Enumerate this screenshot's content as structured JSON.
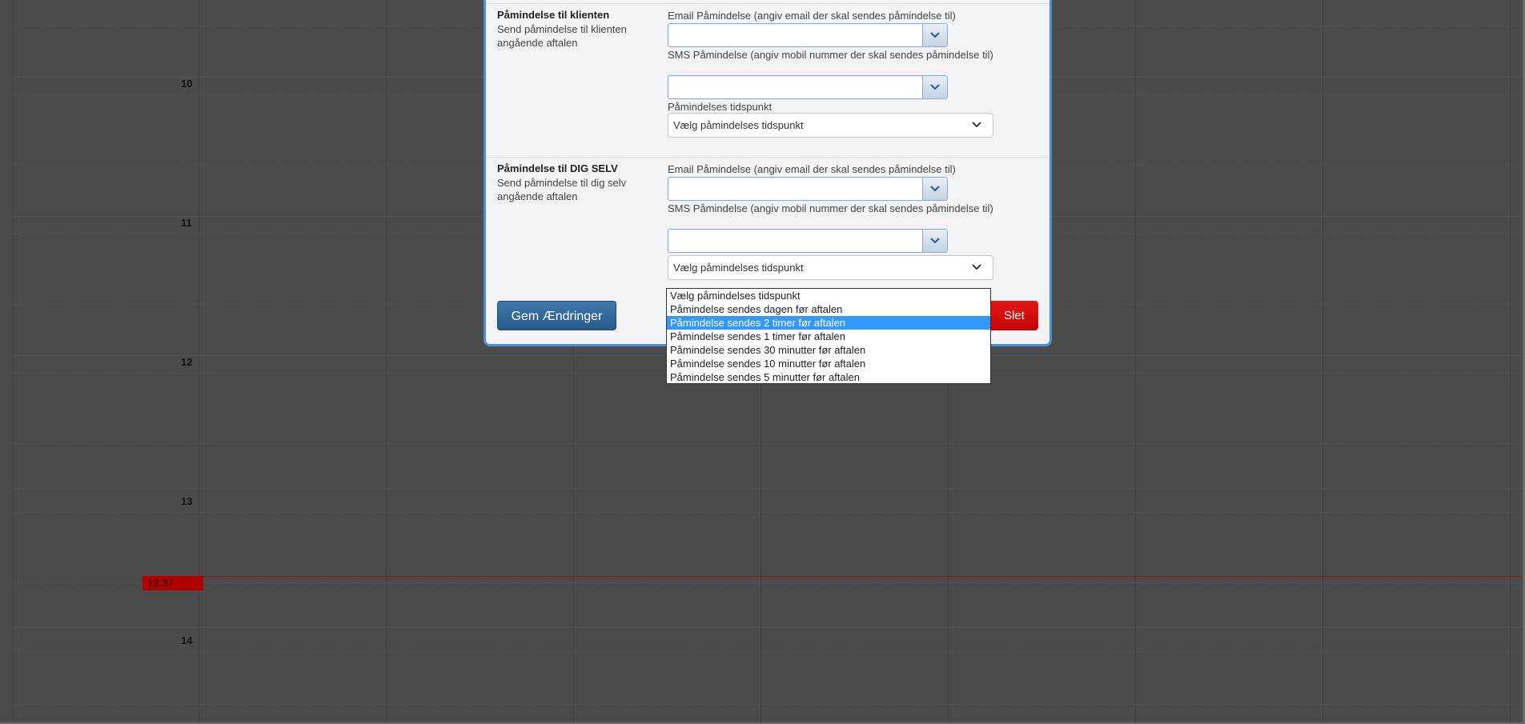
{
  "calendar": {
    "hours": [
      "10",
      "11",
      "12",
      "13",
      "14"
    ],
    "now_label": "13:37"
  },
  "dialog": {
    "section_client": {
      "title": "Påmindelse til klienten",
      "description": "Send påmindelse til klienten angående aftalen",
      "email_label": "Email Påmindelse (angiv email der skal sendes påmindelse til)",
      "email_value": "",
      "sms_label": "SMS Påmindelse (angiv mobil nummer der skal sendes påmindelse til)",
      "sms_value": "",
      "time_label": "Påmindelses tidspunkt",
      "time_value": "Vælg påmindelses tidspunkt"
    },
    "section_self": {
      "title": "Påmindelse til DIG SELV",
      "description": "Send påmindelse til dig selv angående aftalen",
      "email_label": "Email Påmindelse (angiv email der skal sendes påmindelse til)",
      "email_value": "",
      "sms_label": "SMS Påmindelse (angiv mobil nummer der skal sendes påmindelse til)",
      "sms_value": "",
      "time_value": "Vælg påmindelses tidspunkt"
    },
    "save_label": "Gem Ændringer",
    "delete_label": "Slet"
  },
  "dropdown": {
    "options": [
      "Vælg påmindelses tidspunkt",
      "Påmindelse sendes dagen før aftalen",
      "Påmindelse sendes 2 timer før aftalen",
      "Påmindelse sendes 1 timer før aftalen",
      "Påmindelse sendes 30 minutter før aftalen",
      "Påmindelse sendes 10 minutter før aftalen",
      "Påmindelse sendes 5 minutter før aftalen"
    ],
    "highlighted_index": 2
  },
  "colors": {
    "dialog_border": "#4a90d9",
    "save_button": "#2f6a9e",
    "delete_button": "#d40b0b",
    "highlight": "#3399ff",
    "now_marker": "#b00000"
  }
}
